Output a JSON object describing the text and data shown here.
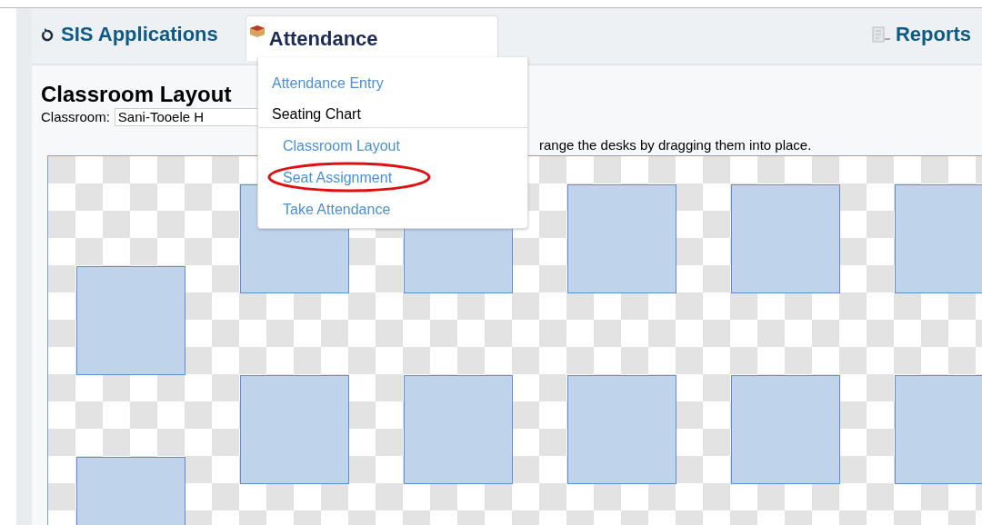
{
  "nav": [
    {
      "label": "SIS Applications",
      "kind": "apps"
    },
    {
      "label": "Attendance",
      "kind": "menu",
      "expanded": true
    },
    {
      "label": "Reports",
      "kind": "reports"
    }
  ],
  "menu": {
    "items": [
      {
        "label": "Attendance Entry",
        "kind": "link"
      },
      {
        "label": "Seating Chart",
        "kind": "header",
        "children": [
          {
            "label": "Classroom Layout",
            "circled": false
          },
          {
            "label": "Seat Assignment",
            "circled": true
          },
          {
            "label": "Take Attendance",
            "circled": false
          }
        ]
      }
    ]
  },
  "page": {
    "title": "Classroom Layout",
    "classroom_label": "Classroom:",
    "classroom_value": "Sani-Tooele H",
    "instruction": "range the desks by dragging them into place."
  }
}
